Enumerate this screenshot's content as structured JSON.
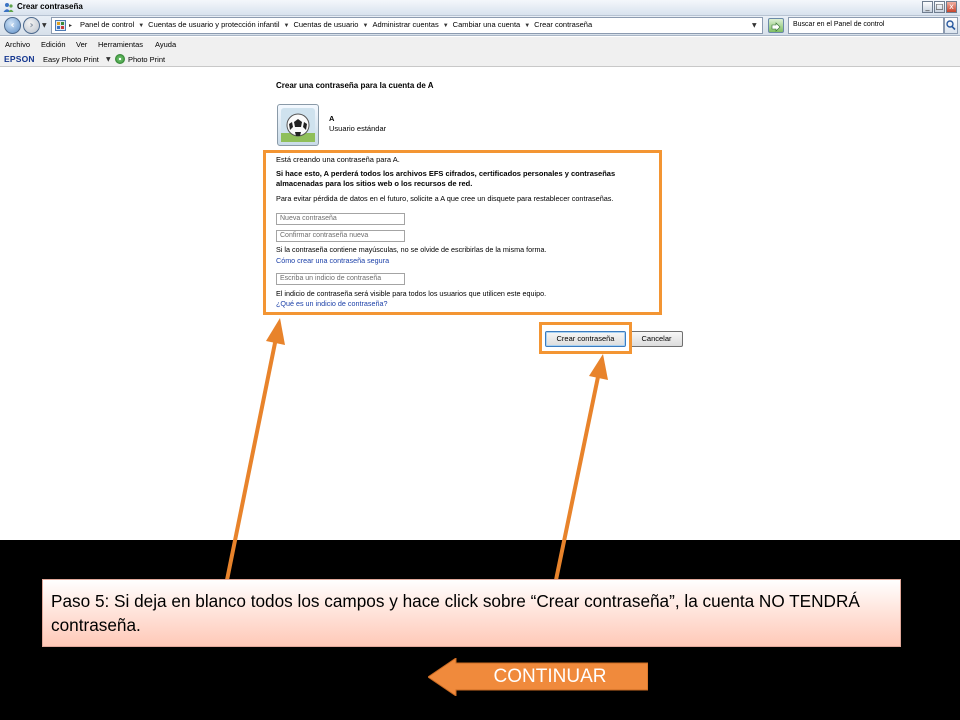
{
  "window": {
    "title": "Crear contraseña",
    "controls": {
      "minimize": "_",
      "maximize": "□",
      "close": "x"
    }
  },
  "address_bar": {
    "breadcrumb": [
      "Panel de control",
      "Cuentas de usuario y protección infantil",
      "Cuentas de usuario",
      "Administrar cuentas",
      "Cambiar una cuenta",
      "Crear contraseña"
    ],
    "search_placeholder": "Buscar en el Panel de control"
  },
  "menu": [
    "Archivo",
    "Edición",
    "Ver",
    "Herramientas",
    "Ayuda"
  ],
  "epson_toolbar": {
    "logo": "EPSON",
    "easy_photo_print": "Easy Photo Print",
    "photo_print": "Photo Print"
  },
  "content": {
    "heading": "Crear una contraseña para la cuenta de A",
    "user_name": "A",
    "user_type": "Usuario estándar",
    "creating_text": "Está creando una contraseña para A.",
    "warning_line1": "Si hace esto, A perderá todos los archivos EFS cifrados, certificados personales y contraseñas",
    "warning_line2": "almacenadas para los sitios web o los recursos de red.",
    "advice": "Para evitar pérdida de datos en el futuro, solicite a A que cree un disquete para restablecer contraseñas.",
    "new_password_placeholder": "Nueva contraseña",
    "confirm_password_placeholder": "Confirmar contraseña nueva",
    "caps_note": "Si la contraseña contiene mayúsculas, no se olvide de escribirlas de la misma forma.",
    "secure_password_link": "Cómo crear una contraseña segura",
    "hint_placeholder": "Escriba un indicio de contraseña",
    "hint_visible_note": "El indicio de contraseña será visible para todos los usuarios que utilicen este equipo.",
    "what_is_hint_link": "¿Qué es un indicio de contraseña?",
    "create_button": "Crear contraseña",
    "cancel_button": "Cancelar"
  },
  "overlay": {
    "caption": "Paso 5: Si deja en blanco todos los campos y hace click sobre “Crear contraseña”, la cuenta NO TENDRÁ contraseña.",
    "continue_button": "CONTINUAR",
    "highlight_color": "#F39533",
    "arrow_color": "#E8832B",
    "continue_color": "#F08A3C"
  }
}
